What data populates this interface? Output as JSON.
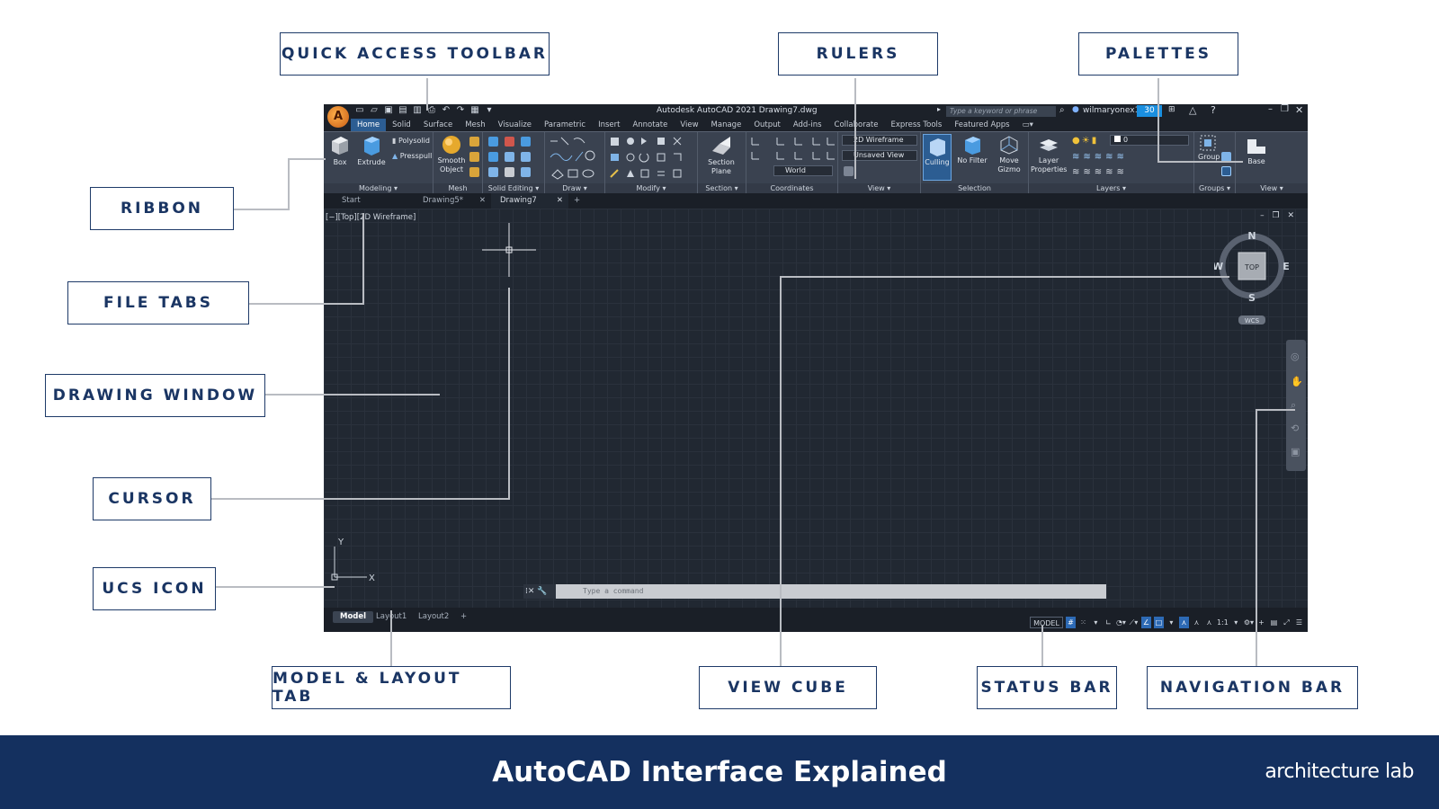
{
  "callouts": {
    "quick_access_toolbar": "QUICK ACCESS TOOLBAR",
    "rulers": "RULERS",
    "palettes": "PALETTES",
    "ribbon": "RIBBON",
    "file_tabs": "FILE TABS",
    "drawing_window": "DRAWING WINDOW",
    "cursor": "CURSOR",
    "ucs_icon": "UCS ICON",
    "model_layout_tab": "MODEL & LAYOUT TAB",
    "view_cube": "VIEW CUBE",
    "status_bar": "STATUS BAR",
    "navigation_bar": "NAVIGATION BAR"
  },
  "app": {
    "title": "Autodesk AutoCAD 2021    Drawing7.dwg",
    "search_placeholder": "Type a keyword or phrase",
    "user": "wilmaryonex13",
    "badge": "30",
    "menu_tabs": [
      "Home",
      "Solid",
      "Surface",
      "Mesh",
      "Visualize",
      "Parametric",
      "Insert",
      "Annotate",
      "View",
      "Manage",
      "Output",
      "Add-ins",
      "Collaborate",
      "Express Tools",
      "Featured Apps"
    ],
    "active_tab": "Home"
  },
  "ribbon": {
    "panels": {
      "modeling": "Modeling ▾",
      "mesh": "Mesh",
      "solid_editing": "Solid Editing ▾",
      "draw": "Draw ▾",
      "modify": "Modify ▾",
      "section": "Section ▾",
      "coordinates": "Coordinates",
      "view": "View ▾",
      "selection": "Selection",
      "layers": "Layers ▾",
      "groups": "Groups ▾",
      "view2": "View ▾"
    },
    "tools": {
      "box": "Box",
      "extrude": "Extrude",
      "polysolid": "Polysolid",
      "presspull": "Presspull",
      "smooth_object": "Smooth\nObject",
      "section_plane": "Section\nPlane",
      "visual_style": "2D Wireframe",
      "saved_view": "Unsaved View",
      "ucs_world": "World",
      "culling": "Culling",
      "no_filter": "No Filter",
      "move_gizmo": "Move\nGizmo",
      "layer_properties": "Layer\nProperties",
      "layer_value": "0",
      "group": "Group",
      "base": "Base"
    }
  },
  "file_tabs": [
    "Start",
    "Drawing5*",
    "Drawing7"
  ],
  "viewport_label": "[−][Top][2D Wireframe]",
  "viewcube": {
    "n": "N",
    "s": "S",
    "e": "E",
    "w": "W",
    "face": "TOP",
    "wcs": "WCS"
  },
  "ucs": {
    "x": "X",
    "y": "Y"
  },
  "command_placeholder": "Type a command",
  "layout_tabs": [
    "Model",
    "Layout1",
    "Layout2"
  ],
  "status": {
    "model": "MODEL",
    "scale": "1:1"
  },
  "footer": {
    "title": "AutoCAD Interface Explained",
    "brand": "architecture lab"
  }
}
